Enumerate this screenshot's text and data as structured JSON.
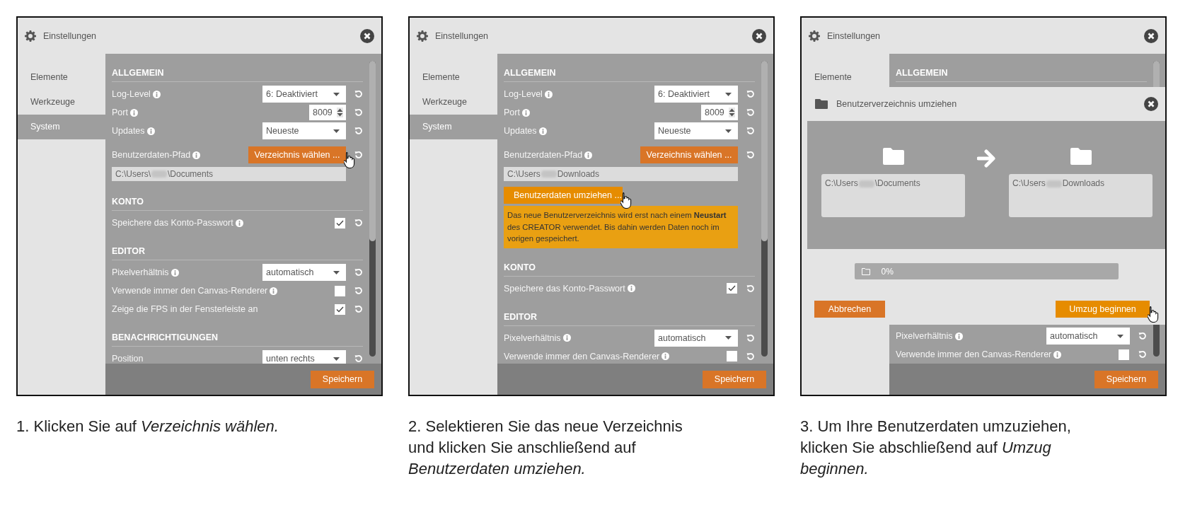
{
  "panels": [
    {
      "window": {
        "title": "Einstellungen"
      },
      "sidebar": {
        "items": [
          {
            "label": "Elemente",
            "selected": false
          },
          {
            "label": "Werkzeuge",
            "selected": false
          },
          {
            "label": "System",
            "selected": true
          }
        ]
      },
      "sections": [
        {
          "title": "ALLGEMEIN",
          "rows": [
            {
              "kind": "select",
              "label": "Log-Level",
              "info": true,
              "value": "6: Deaktiviert",
              "reset": true
            },
            {
              "kind": "number",
              "label": "Port",
              "info": true,
              "value": "8009",
              "reset": true
            },
            {
              "kind": "select",
              "label": "Updates",
              "info": true,
              "value": "Neueste",
              "reset": true
            },
            {
              "kind": "button",
              "label": "Benutzerdaten-Pfad",
              "info": true,
              "button": "Verzeichnis wählen ...",
              "pointer": true,
              "reset": true
            },
            {
              "kind": "path",
              "prefix": "C:\\Users\\",
              "suffix": "\\Documents"
            }
          ]
        },
        {
          "title": "KONTO",
          "rows": [
            {
              "kind": "checkbox",
              "label": "Speichere das Konto-Passwort",
              "info": true,
              "checked": true,
              "reset": true
            }
          ]
        },
        {
          "title": "EDITOR",
          "rows": [
            {
              "kind": "select",
              "label": "Pixelverhältnis",
              "info": true,
              "value": "automatisch",
              "reset": true
            },
            {
              "kind": "checkbox",
              "label": "Verwende immer den Canvas-Renderer",
              "info": true,
              "checked": false,
              "reset": true
            },
            {
              "kind": "checkbox",
              "label": "Zeige die FPS in der Fensterleiste an",
              "info": false,
              "checked": true,
              "reset": true
            }
          ]
        },
        {
          "title": "BENACHRICHTIGUNGEN",
          "rows": [
            {
              "kind": "select",
              "label": "Position",
              "info": false,
              "value": "unten rechts",
              "reset": true
            }
          ]
        }
      ],
      "footer": {
        "button": "Speichern"
      }
    },
    {
      "window": {
        "title": "Einstellungen"
      },
      "sidebar": {
        "items": [
          {
            "label": "Elemente",
            "selected": false
          },
          {
            "label": "Werkzeuge",
            "selected": false
          },
          {
            "label": "System",
            "selected": true
          }
        ]
      },
      "sections": [
        {
          "title": "ALLGEMEIN",
          "rows": [
            {
              "kind": "select",
              "label": "Log-Level",
              "info": true,
              "value": "6: Deaktiviert",
              "reset": true
            },
            {
              "kind": "number",
              "label": "Port",
              "info": true,
              "value": "8009",
              "reset": true
            },
            {
              "kind": "select",
              "label": "Updates",
              "info": true,
              "value": "Neueste",
              "reset": true
            },
            {
              "kind": "button",
              "label": "Benutzerdaten-Pfad",
              "info": true,
              "button": "Verzeichnis wählen ...",
              "pointer": false,
              "reset": true
            },
            {
              "kind": "path",
              "prefix": "C:\\Users",
              "suffix": "Downloads"
            },
            {
              "kind": "action",
              "button": "Benutzerdaten umziehen ...",
              "pointer": true
            },
            {
              "kind": "notice",
              "text": "Das neue Benutzerverzeichnis wird erst nach einem **Neustart** des CREATOR verwendet. Bis dahin werden Daten noch im vorigen gespeichert."
            }
          ]
        },
        {
          "title": "KONTO",
          "rows": [
            {
              "kind": "checkbox",
              "label": "Speichere das Konto-Passwort",
              "info": true,
              "checked": true,
              "reset": true
            }
          ]
        },
        {
          "title": "EDITOR",
          "rows": [
            {
              "kind": "select",
              "label": "Pixelverhältnis",
              "info": true,
              "value": "automatisch",
              "reset": true
            },
            {
              "kind": "checkbox",
              "label": "Verwende immer den Canvas-Renderer",
              "info": true,
              "checked": false,
              "reset": true
            }
          ]
        }
      ],
      "footer": {
        "button": "Speichern"
      }
    },
    {
      "window": {
        "title": "Einstellungen"
      },
      "sidebar": {
        "items": [
          {
            "label": "Elemente",
            "selected": false
          }
        ]
      },
      "sections": [
        {
          "title": "ALLGEMEIN"
        },
        {
          "rows": [
            {
              "kind": "select",
              "label": "Pixelverhältnis",
              "info": true,
              "value": "automatisch",
              "reset": true
            },
            {
              "kind": "checkbox",
              "label": "Verwende immer den Canvas-Renderer",
              "info": true,
              "checked": false,
              "reset": true
            }
          ]
        }
      ],
      "footer": {
        "button": "Speichern"
      },
      "dialog": {
        "title": "Benutzerverzeichnis umziehen",
        "source": {
          "prefix": "C:\\Users",
          "suffix": "\\Documents"
        },
        "target": {
          "prefix": "C:\\Users",
          "suffix": "Downloads"
        },
        "progress": {
          "level": 0,
          "label": "0%"
        },
        "buttons": [
          {
            "kind": "cancel",
            "label": "Abbrechen",
            "pointer": false
          },
          {
            "kind": "confirm",
            "label": "Umzug beginnen",
            "pointer": true
          }
        ]
      }
    }
  ],
  "captions": [
    {
      "lines": [
        "1. Klicken Sie auf *Verzeichnis wählen.*"
      ]
    },
    {
      "lines": [
        "2. Selektieren Sie das neue Verzeichnis",
        "und klicken Sie anschließend auf",
        "*Benutzerdaten umziehen.*"
      ]
    },
    {
      "lines": [
        "3. Um Ihre Benutzerdaten umzuziehen,",
        "klicken Sie abschließend auf *Umzug*",
        "*beginnen.*"
      ]
    }
  ]
}
